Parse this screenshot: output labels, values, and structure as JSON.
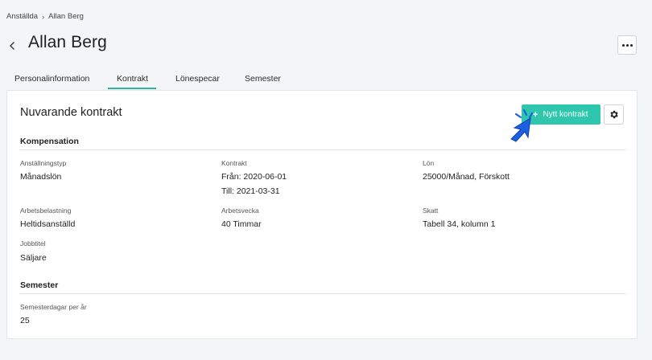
{
  "breadcrumb": {
    "parent": "Anställda",
    "separator": "›",
    "current": "Allan Berg"
  },
  "page": {
    "title": "Allan Berg"
  },
  "tabs": [
    {
      "label": "Personalinformation"
    },
    {
      "label": "Kontrakt",
      "active": true
    },
    {
      "label": "Lönespecar"
    },
    {
      "label": "Semester"
    }
  ],
  "card": {
    "title": "Nuvarande kontrakt",
    "new_button": {
      "icon": "plus-icon",
      "label": "Nytt kontrakt"
    },
    "settings_icon": "gear-icon"
  },
  "compensation": {
    "title": "Kompensation",
    "employment_type": {
      "label": "Anställningstyp",
      "value": "Månadslön"
    },
    "contract": {
      "label": "Kontrakt",
      "from": "Från: 2020-06-01",
      "to": "Till: 2021-03-31"
    },
    "salary": {
      "label": "Lön",
      "value": "25000/Månad, Förskott"
    },
    "workload": {
      "label": "Arbetsbelastning",
      "value": "Heltidsanställd"
    },
    "work_week": {
      "label": "Arbetsvecka",
      "value": "40 Timmar"
    },
    "tax": {
      "label": "Skatt",
      "value": "Tabell 34, kolumn 1"
    },
    "job_title": {
      "label": "Jobbtitel",
      "value": "Säljare"
    }
  },
  "vacation": {
    "title": "Semester",
    "days_per_year": {
      "label": "Semesterdagar per år",
      "value": "25"
    }
  },
  "colors": {
    "accent": "#2ec7ad",
    "cursor": "#1e5fe0"
  }
}
